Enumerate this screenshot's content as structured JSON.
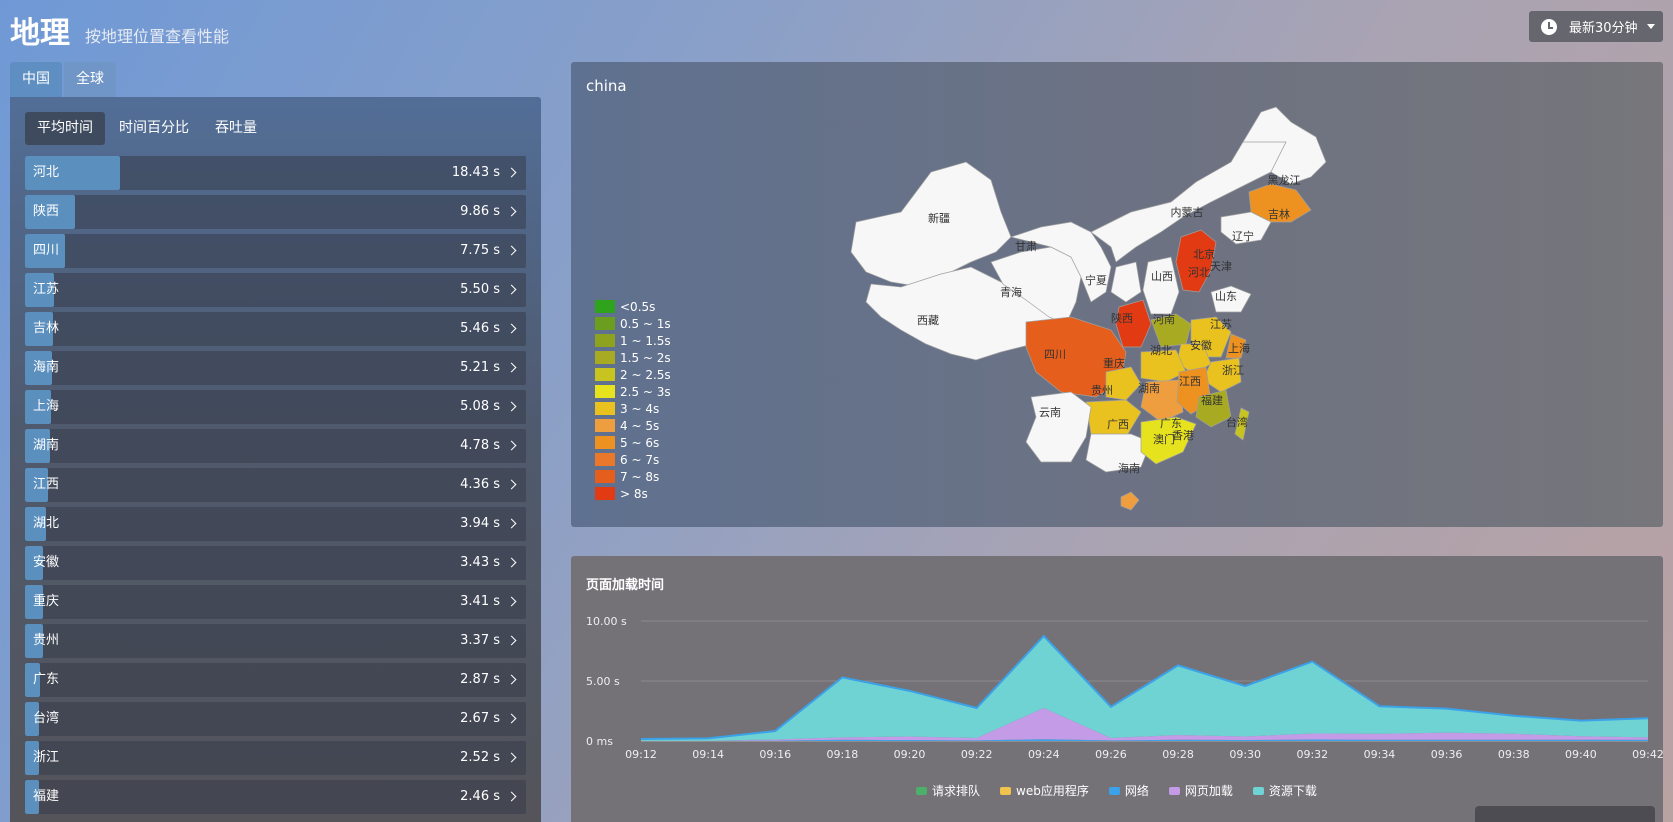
{
  "header": {
    "title": "地理",
    "subtitle": "按地理位置查看性能",
    "time_range": "最新30分钟"
  },
  "region_tabs": [
    "中国",
    "全球"
  ],
  "metric_tabs": [
    "平均时间",
    "时间百分比",
    "吞吐量"
  ],
  "provinces": [
    {
      "name": "河北",
      "value": "18.43 s",
      "fraction": 0.19
    },
    {
      "name": "陕西",
      "value": "9.86 s",
      "fraction": 0.1
    },
    {
      "name": "四川",
      "value": "7.75 s",
      "fraction": 0.08
    },
    {
      "name": "江苏",
      "value": "5.50 s",
      "fraction": 0.057
    },
    {
      "name": "吉林",
      "value": "5.46 s",
      "fraction": 0.056
    },
    {
      "name": "海南",
      "value": "5.21 s",
      "fraction": 0.054
    },
    {
      "name": "上海",
      "value": "5.08 s",
      "fraction": 0.052
    },
    {
      "name": "湖南",
      "value": "4.78 s",
      "fraction": 0.049
    },
    {
      "name": "江西",
      "value": "4.36 s",
      "fraction": 0.045
    },
    {
      "name": "湖北",
      "value": "3.94 s",
      "fraction": 0.041
    },
    {
      "name": "安徽",
      "value": "3.43 s",
      "fraction": 0.035
    },
    {
      "name": "重庆",
      "value": "3.41 s",
      "fraction": 0.035
    },
    {
      "name": "贵州",
      "value": "3.37 s",
      "fraction": 0.035
    },
    {
      "name": "广东",
      "value": "2.87 s",
      "fraction": 0.03
    },
    {
      "name": "台湾",
      "value": "2.67 s",
      "fraction": 0.028
    },
    {
      "name": "浙江",
      "value": "2.52 s",
      "fraction": 0.026
    },
    {
      "name": "福建",
      "value": "2.46 s",
      "fraction": 0.025
    }
  ],
  "map": {
    "title": "china",
    "legend": [
      {
        "label": "<0.5s",
        "color": "#2ea31b"
      },
      {
        "label": "0.5 ~ 1s",
        "color": "#6b9e1e"
      },
      {
        "label": "1 ~ 1.5s",
        "color": "#8da320"
      },
      {
        "label": "1.5 ~ 2s",
        "color": "#a8ab22"
      },
      {
        "label": "2 ~ 2.5s",
        "color": "#c7c31f"
      },
      {
        "label": "2.5 ~ 3s",
        "color": "#e6e21e"
      },
      {
        "label": "3 ~ 4s",
        "color": "#eac21f"
      },
      {
        "label": "4 ~ 5s",
        "color": "#ee9e3e"
      },
      {
        "label": "5 ~ 6s",
        "color": "#ed9121"
      },
      {
        "label": "6 ~ 7s",
        "color": "#e9782b"
      },
      {
        "label": "7 ~ 8s",
        "color": "#e55e1b"
      },
      {
        "label": "> 8s",
        "color": "#e23a12"
      }
    ],
    "province_labels": [
      "黑龙江",
      "吉林",
      "辽宁",
      "内蒙古",
      "北京",
      "天津",
      "河北",
      "山西",
      "山东",
      "新疆",
      "甘肃",
      "宁夏",
      "青海",
      "西藏",
      "陕西",
      "河南",
      "江苏",
      "上海",
      "安徽",
      "湖北",
      "四川",
      "重庆",
      "浙江",
      "湖南",
      "江西",
      "贵州",
      "福建",
      "云南",
      "广西",
      "广东",
      "台湾",
      "澳门",
      "香港",
      "海南"
    ]
  },
  "chart": {
    "title": "页面加载时间",
    "legend_labels": [
      "请求排队",
      "web应用程序",
      "网络",
      "网页加载",
      "资源下载"
    ]
  },
  "chart_data": {
    "type": "area",
    "title": "页面加载时间",
    "x": [
      "09:12",
      "09:14",
      "09:16",
      "09:18",
      "09:20",
      "09:22",
      "09:24",
      "09:26",
      "09:28",
      "09:30",
      "09:32",
      "09:34",
      "09:36",
      "09:38",
      "09:40",
      "09:42"
    ],
    "x_ticks": [
      "09:12",
      "09:14",
      "09:16",
      "09:18",
      "09:20",
      "09:22",
      "09:24",
      "09:26",
      "09:28",
      "09:30",
      "09:32",
      "09:34",
      "09:36",
      "09:38",
      "09:40",
      "09:42"
    ],
    "y_ticks": [
      "0 ms",
      "5.00 s",
      "10.00 s"
    ],
    "ylim": [
      0,
      10
    ],
    "series": [
      {
        "name": "请求排队",
        "color": "#4caf6a",
        "values": [
          0,
          0,
          0,
          0,
          0,
          0,
          0,
          0,
          0,
          0,
          0,
          0,
          0,
          0,
          0,
          0
        ]
      },
      {
        "name": "web应用程序",
        "color": "#f0c24e",
        "values": [
          0,
          0,
          0,
          0,
          0,
          0,
          0,
          0,
          0,
          0,
          0,
          0,
          0,
          0,
          0,
          0
        ]
      },
      {
        "name": "网络",
        "color": "#3ba1e8",
        "values": [
          0.02,
          0.02,
          0.03,
          0.1,
          0.08,
          0.05,
          0.15,
          0.05,
          0.1,
          0.08,
          0.12,
          0.1,
          0.1,
          0.1,
          0.1,
          0.1
        ]
      },
      {
        "name": "网页加载",
        "color": "#c39be6",
        "values": [
          0.0,
          0.0,
          0.1,
          0.2,
          0.3,
          0.2,
          2.6,
          0.2,
          0.4,
          0.3,
          0.5,
          0.5,
          0.6,
          0.5,
          0.3,
          0.2
        ]
      },
      {
        "name": "资源下载",
        "color": "#6fd3d3",
        "values": [
          0.15,
          0.2,
          0.7,
          5.0,
          3.8,
          2.5,
          6.0,
          2.6,
          5.8,
          4.2,
          6.0,
          2.3,
          2.0,
          1.5,
          1.3,
          1.6
        ]
      }
    ]
  }
}
